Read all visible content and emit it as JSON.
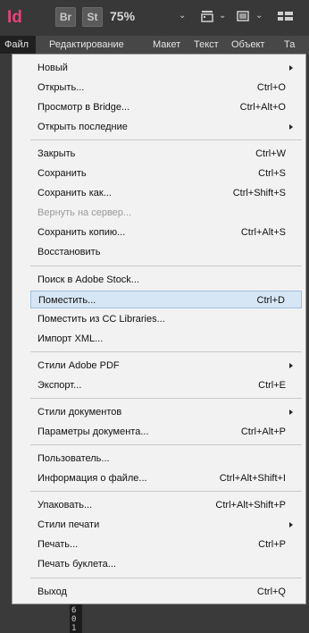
{
  "app": {
    "logo": "Id",
    "bridge_chip": "Br",
    "stock_chip": "St",
    "zoom": "75%"
  },
  "menubar": [
    "Файл",
    "Редактирование",
    "Макет",
    "Текст",
    "Объект",
    "Та"
  ],
  "menu": {
    "items": [
      {
        "label": "Новый",
        "shortcut": "",
        "submenu": true
      },
      {
        "label": "Открыть...",
        "shortcut": "Ctrl+O"
      },
      {
        "label": "Просмотр в Bridge...",
        "shortcut": "Ctrl+Alt+O"
      },
      {
        "label": "Открыть последние",
        "shortcut": "",
        "submenu": true
      },
      {
        "label": "Закрыть",
        "shortcut": "Ctrl+W"
      },
      {
        "label": "Сохранить",
        "shortcut": "Ctrl+S"
      },
      {
        "label": "Сохранить как...",
        "shortcut": "Ctrl+Shift+S"
      },
      {
        "label": "Вернуть на сервер...",
        "shortcut": "",
        "disabled": true
      },
      {
        "label": "Сохранить копию...",
        "shortcut": "Ctrl+Alt+S"
      },
      {
        "label": "Восстановить",
        "shortcut": ""
      },
      {
        "label": "Поиск в Adobe Stock...",
        "shortcut": ""
      },
      {
        "label": "Поместить...",
        "shortcut": "Ctrl+D",
        "highlighted": true
      },
      {
        "label": "Поместить из CC Libraries...",
        "shortcut": ""
      },
      {
        "label": "Импорт XML...",
        "shortcut": ""
      },
      {
        "label": "Стили Adobe PDF",
        "shortcut": "",
        "submenu": true
      },
      {
        "label": "Экспорт...",
        "shortcut": "Ctrl+E"
      },
      {
        "label": "Стили документов",
        "shortcut": "",
        "submenu": true
      },
      {
        "label": "Параметры документа...",
        "shortcut": "Ctrl+Alt+P"
      },
      {
        "label": "Пользователь...",
        "shortcut": ""
      },
      {
        "label": "Информация о файле...",
        "shortcut": "Ctrl+Alt+Shift+I"
      },
      {
        "label": "Упаковать...",
        "shortcut": "Ctrl+Alt+Shift+P"
      },
      {
        "label": "Стили печати",
        "shortcut": "",
        "submenu": true
      },
      {
        "label": "Печать...",
        "shortcut": "Ctrl+P"
      },
      {
        "label": "Печать буклета...",
        "shortcut": ""
      },
      {
        "label": "Выход",
        "shortcut": "Ctrl+Q"
      }
    ]
  },
  "ruler": [
    "6",
    "0",
    "1"
  ],
  "colors": {
    "menu_bg": "#f2f2f2",
    "highlight_bg": "#d7e6f4",
    "highlight_border": "#9ebfdf",
    "appbar_bg": "#383838",
    "logo": "#e8437a"
  }
}
